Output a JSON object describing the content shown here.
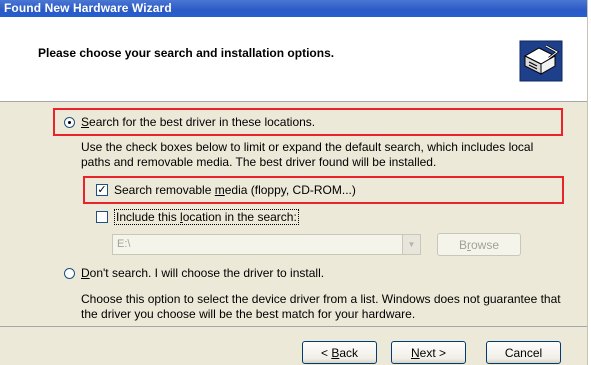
{
  "window": {
    "title": "Found New Hardware Wizard"
  },
  "header": {
    "title": "Please choose your search and installation options.",
    "icon": "hardware-wizard-icon"
  },
  "options": {
    "search": {
      "label_underlined": "S",
      "label_rest": "earch for the best driver in these locations.",
      "checked": true,
      "description": "Use the check boxes below to limit or expand the default search, which includes local paths and removable media. The best driver found will be installed."
    },
    "removable": {
      "label_before": "Search removable ",
      "label_underlined": "m",
      "label_after": "edia (floppy, CD-ROM...)",
      "checked": true
    },
    "include": {
      "label_before": "Include this ",
      "label_underlined": "l",
      "label_after": "ocation in the search:",
      "checked": false
    },
    "location": {
      "value": "E:\\",
      "enabled": false
    },
    "browse": {
      "label_before": "B",
      "label_underlined": "r",
      "label_after": "owse"
    },
    "dont_search": {
      "label_underlined": "D",
      "label_rest": "on't search. I will choose the driver to install.",
      "checked": false,
      "description": "Choose this option to select the device driver from a list.  Windows does not guarantee that the driver you choose will be the best match for your hardware."
    }
  },
  "buttons": {
    "back": {
      "prefix": "< ",
      "underlined": "B",
      "rest": "ack"
    },
    "next": {
      "underlined": "N",
      "rest": "ext >"
    },
    "cancel": {
      "label": "Cancel"
    }
  },
  "colors": {
    "highlight": "#e8232a",
    "titlebar": "#2b5ac4"
  }
}
